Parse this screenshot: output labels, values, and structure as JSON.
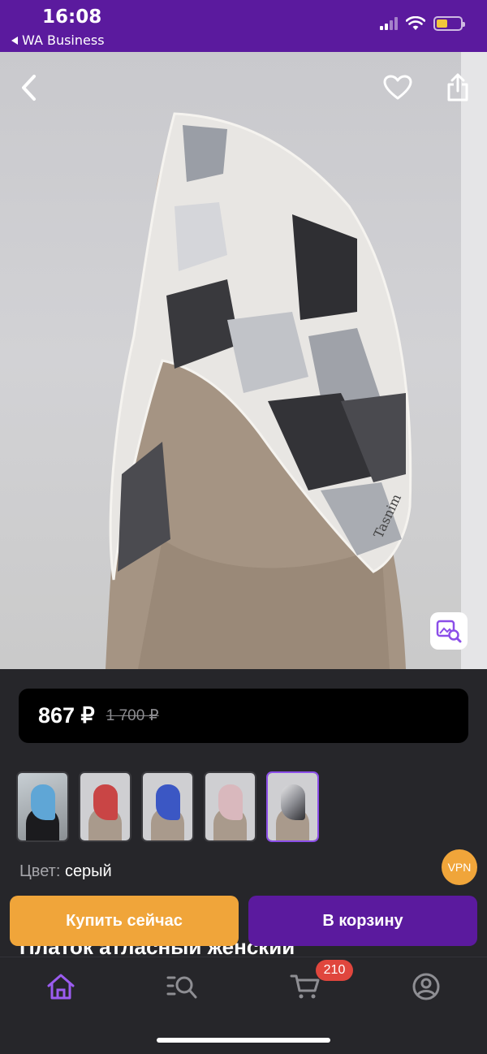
{
  "status_bar": {
    "time": "16:08",
    "back_app": "WA Business"
  },
  "product": {
    "price_current": "867 ₽",
    "price_old": "1 700 ₽",
    "color_label": "Цвет:",
    "color_value": "серый",
    "title": "Платок атласный женский",
    "variant_swatches": [
      {
        "name": "blue-print",
        "color": "#3b7ac0"
      },
      {
        "name": "red",
        "color": "#c53a3a"
      },
      {
        "name": "blue",
        "color": "#3a56c5"
      },
      {
        "name": "pink",
        "color": "#d9b3b8"
      },
      {
        "name": "grey",
        "color": "#8a8a90"
      }
    ]
  },
  "badges": {
    "vpn": "VPN",
    "cart_count": "210"
  },
  "actions": {
    "buy_now": "Купить сейчас",
    "add_to_cart": "В корзину"
  },
  "colors": {
    "accent": "#5b1a9e",
    "orange": "#f0a53a",
    "badge_red": "#e0463d"
  },
  "tabbar": {
    "items": [
      {
        "icon": "home-icon",
        "active": true
      },
      {
        "icon": "catalog-search-icon",
        "active": false
      },
      {
        "icon": "cart-icon",
        "active": false
      },
      {
        "icon": "profile-icon",
        "active": false
      }
    ]
  }
}
